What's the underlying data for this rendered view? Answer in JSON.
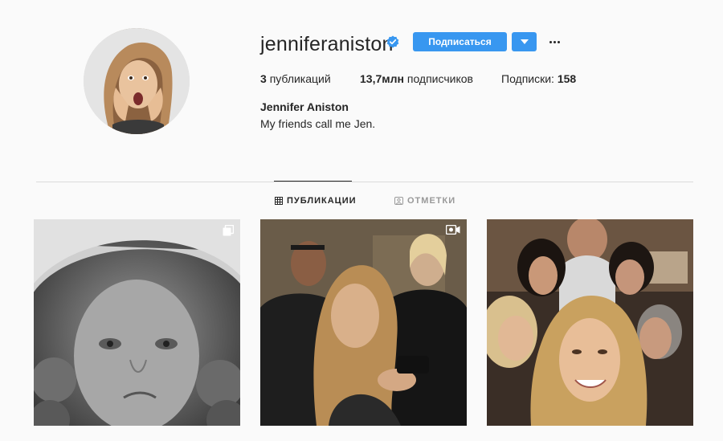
{
  "profile": {
    "username": "jenniferaniston",
    "verified": true,
    "follow_label": "Подписаться",
    "posts_count": "3",
    "posts_label": "публикаций",
    "followers_count": "13,7млн",
    "followers_label": "подписчиков",
    "following_label": "Подписки:",
    "following_count": "158",
    "full_name": "Jennifer Aniston",
    "bio": "My friends call me Jen."
  },
  "tabs": [
    {
      "label": "ПУБЛИКАЦИИ",
      "icon": "grid-icon",
      "active": true
    },
    {
      "label": "ОТМЕТКИ",
      "icon": "tagged-icon",
      "active": false
    }
  ],
  "posts": [
    {
      "type": "carousel",
      "icon": "carousel-icon",
      "description": "black-and-white childhood portrait"
    },
    {
      "type": "video",
      "icon": "video-icon",
      "description": "group photo"
    },
    {
      "type": "photo",
      "icon": "",
      "description": "friends selfie"
    }
  ],
  "colors": {
    "accent": "#3897f0",
    "verified": "#3897f0",
    "text": "#262626",
    "muted": "#999999",
    "background": "#fafafa"
  }
}
